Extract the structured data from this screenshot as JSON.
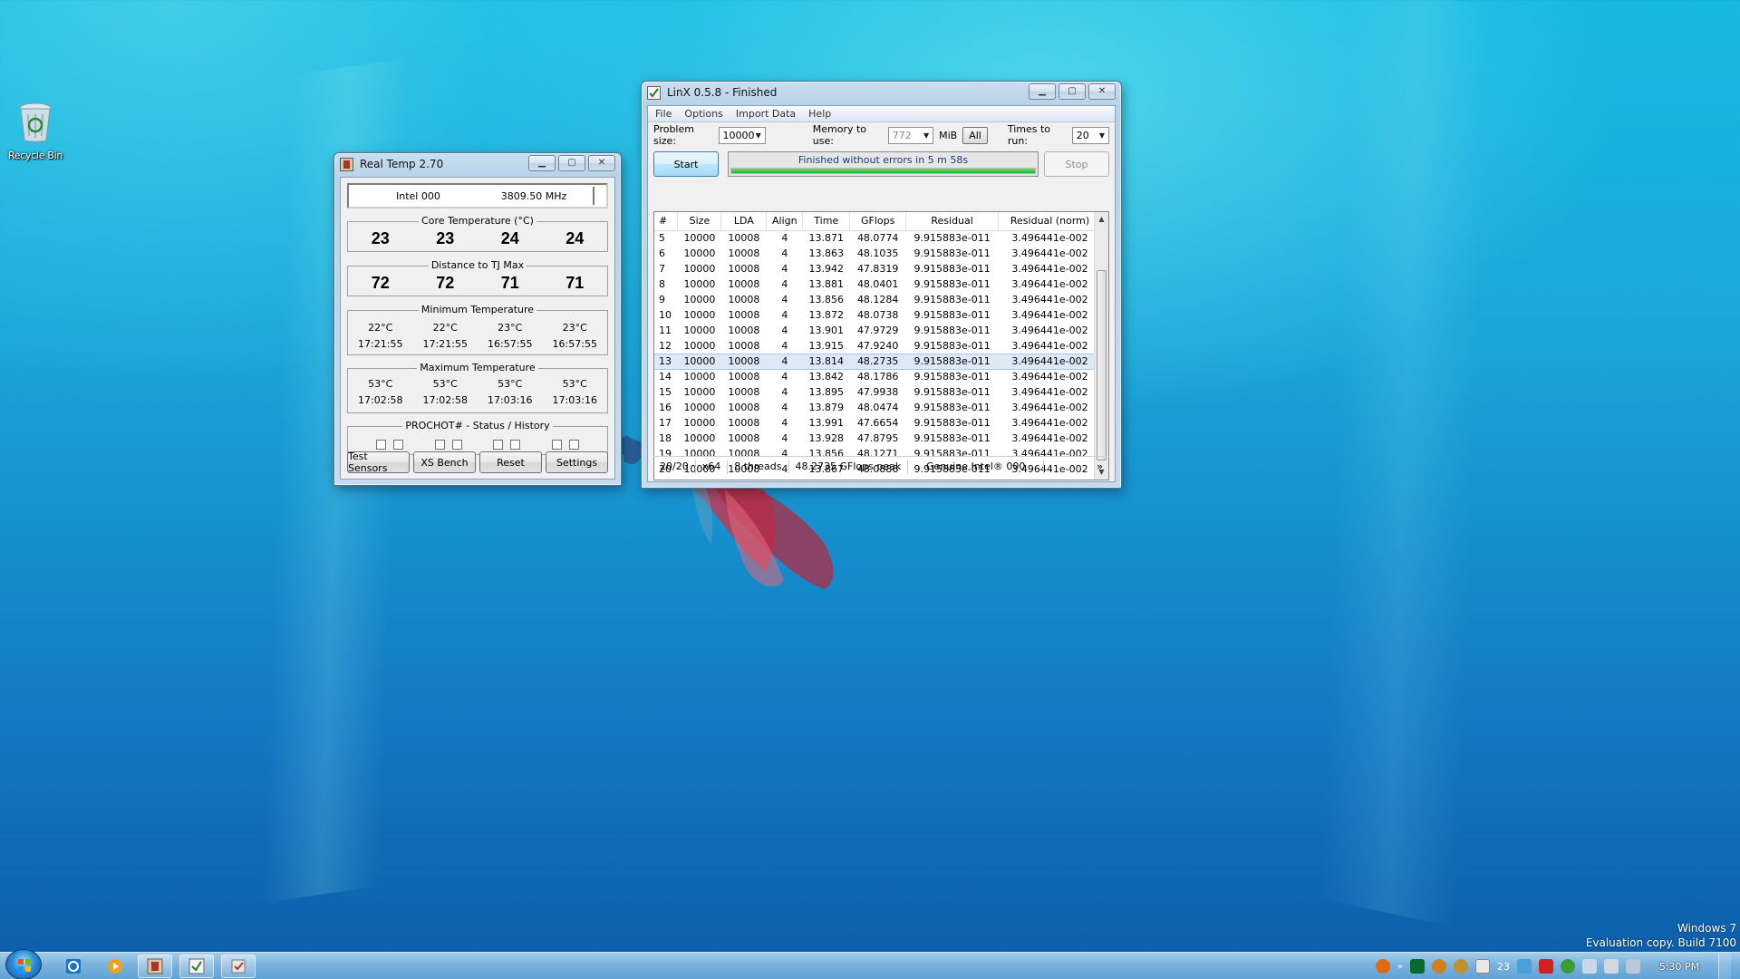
{
  "desktop": {
    "recycle_bin_label": "Recycle Bin",
    "watermark_line1": "Windows 7",
    "watermark_line2": "Evaluation copy. Build 7100"
  },
  "realtemp": {
    "title": "Real Temp 2.70",
    "cpu_name": "Intel 000",
    "cpu_mhz": "3809.50 MHz",
    "core_temp_title": "Core Temperature (°C)",
    "core_temps": [
      "23",
      "23",
      "24",
      "24"
    ],
    "distance_title": "Distance to TJ Max",
    "distance_values": [
      "72",
      "72",
      "71",
      "71"
    ],
    "min_title": "Minimum Temperature",
    "min_temps": [
      "22°C",
      "22°C",
      "23°C",
      "23°C"
    ],
    "min_times": [
      "17:21:55",
      "17:21:55",
      "16:57:55",
      "16:57:55"
    ],
    "max_title": "Maximum Temperature",
    "max_temps": [
      "53°C",
      "53°C",
      "53°C",
      "53°C"
    ],
    "max_times": [
      "17:02:58",
      "17:02:58",
      "17:03:16",
      "17:03:16"
    ],
    "prochot_title": "PROCHOT#  -  Status / History",
    "buttons": {
      "test_sensors": "Test Sensors",
      "xs_bench": "XS Bench",
      "reset": "Reset",
      "settings": "Settings"
    }
  },
  "linx": {
    "title": "LinX 0.5.8 - Finished",
    "menu": [
      "File",
      "Options",
      "Import Data",
      "Help"
    ],
    "problem_size_label": "Problem size:",
    "problem_size_value": "10000",
    "memory_label": "Memory to use:",
    "memory_value": "772",
    "memory_unit": "MiB",
    "all_button": "All",
    "times_label": "Times to run:",
    "times_value": "20",
    "start_button": "Start",
    "stop_button": "Stop",
    "progress_text": "Finished without errors in 5 m 58s",
    "progress_fraction": 1.0,
    "columns": [
      "#",
      "Size",
      "LDA",
      "Align",
      "Time",
      "GFlops",
      "Residual",
      "Residual (norm)"
    ],
    "rows": [
      [
        "5",
        "10000",
        "10008",
        "4",
        "13.871",
        "48.0774",
        "9.915883e-011",
        "3.496441e-002"
      ],
      [
        "6",
        "10000",
        "10008",
        "4",
        "13.863",
        "48.1035",
        "9.915883e-011",
        "3.496441e-002"
      ],
      [
        "7",
        "10000",
        "10008",
        "4",
        "13.942",
        "47.8319",
        "9.915883e-011",
        "3.496441e-002"
      ],
      [
        "8",
        "10000",
        "10008",
        "4",
        "13.881",
        "48.0401",
        "9.915883e-011",
        "3.496441e-002"
      ],
      [
        "9",
        "10000",
        "10008",
        "4",
        "13.856",
        "48.1284",
        "9.915883e-011",
        "3.496441e-002"
      ],
      [
        "10",
        "10000",
        "10008",
        "4",
        "13.872",
        "48.0738",
        "9.915883e-011",
        "3.496441e-002"
      ],
      [
        "11",
        "10000",
        "10008",
        "4",
        "13.901",
        "47.9729",
        "9.915883e-011",
        "3.496441e-002"
      ],
      [
        "12",
        "10000",
        "10008",
        "4",
        "13.915",
        "47.9240",
        "9.915883e-011",
        "3.496441e-002"
      ],
      [
        "13",
        "10000",
        "10008",
        "4",
        "13.814",
        "48.2735",
        "9.915883e-011",
        "3.496441e-002"
      ],
      [
        "14",
        "10000",
        "10008",
        "4",
        "13.842",
        "48.1786",
        "9.915883e-011",
        "3.496441e-002"
      ],
      [
        "15",
        "10000",
        "10008",
        "4",
        "13.895",
        "47.9938",
        "9.915883e-011",
        "3.496441e-002"
      ],
      [
        "16",
        "10000",
        "10008",
        "4",
        "13.879",
        "48.0474",
        "9.915883e-011",
        "3.496441e-002"
      ],
      [
        "17",
        "10000",
        "10008",
        "4",
        "13.991",
        "47.6654",
        "9.915883e-011",
        "3.496441e-002"
      ],
      [
        "18",
        "10000",
        "10008",
        "4",
        "13.928",
        "47.8795",
        "9.915883e-011",
        "3.496441e-002"
      ],
      [
        "19",
        "10000",
        "10008",
        "4",
        "13.856",
        "48.1271",
        "9.915883e-011",
        "3.496441e-002"
      ],
      [
        "20",
        "10000",
        "10008",
        "4",
        "13.867",
        "48.0886",
        "9.915883e-011",
        "3.496441e-002"
      ]
    ],
    "selected_row": "13",
    "status": {
      "runs": "20/20",
      "arch": "x64",
      "threads": "8 threads",
      "peak": "48.2735 GFlops peak",
      "cpu": "Genuine Intel® 000",
      "more": "»"
    }
  },
  "taskbar": {
    "clock": "5:30 PM",
    "tray_temp": "23",
    "overflow": "»"
  },
  "colors": {
    "accent": "#3c7fb1",
    "progress_green": "#14b82a",
    "selection": "#dde9f7"
  }
}
